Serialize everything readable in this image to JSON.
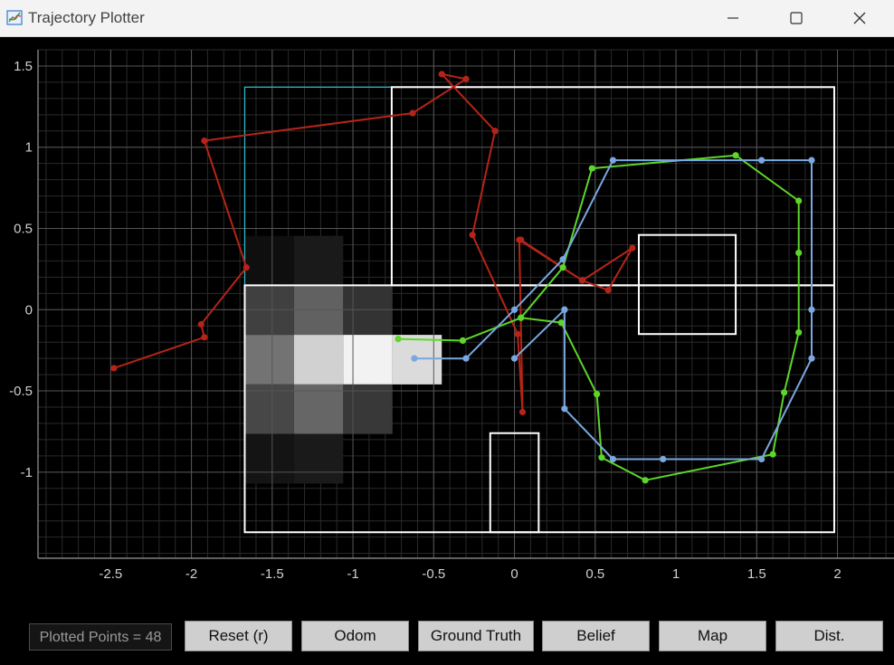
{
  "window": {
    "title": "Trajectory Plotter",
    "icon": "chart-app-icon",
    "minimize_icon": "minimize-icon",
    "maximize_icon": "maximize-icon",
    "close_icon": "close-icon"
  },
  "colors": {
    "odom": "#b52418",
    "ground_truth": "#5cd62a",
    "belief": "#7aa7e0",
    "map": "#ffffff",
    "highlight_rect": "#2fb8c8",
    "grid": "#555555",
    "background": "#000000"
  },
  "chart_data": {
    "type": "line",
    "xlim": [
      -2.95,
      2.35
    ],
    "ylim": [
      -1.53,
      1.6
    ],
    "x_ticks": [
      -2.5,
      -2,
      -1.5,
      -1,
      -0.5,
      0,
      0.5,
      1,
      1.5,
      2
    ],
    "x_tick_labels": [
      "-2.5",
      "-2",
      "-1.5",
      "-1",
      "-0.5",
      "0",
      "0.5",
      "1",
      "1.5",
      "2"
    ],
    "y_ticks": [
      1.5,
      1,
      0.5,
      0,
      -0.5,
      -1
    ],
    "y_tick_labels": [
      "1.5",
      "1",
      "0.5",
      "0",
      "-0.5",
      "-1"
    ],
    "grid": true,
    "series": [
      {
        "key": "odom",
        "x": [
          -2.48,
          -1.92,
          -1.94,
          -1.66,
          -1.92,
          -0.63,
          -0.3,
          -0.45,
          -0.12,
          -0.26,
          0.02,
          0.05,
          0.03,
          0.42,
          0.58,
          0.73,
          0.42,
          0.04
        ],
        "y": [
          -0.36,
          -0.17,
          -0.09,
          0.26,
          1.04,
          1.21,
          1.42,
          1.45,
          1.1,
          0.46,
          -0.15,
          -0.63,
          0.43,
          0.18,
          0.12,
          0.38,
          0.18,
          0.43
        ]
      },
      {
        "key": "ground_truth",
        "x": [
          -0.72,
          -0.32,
          0.04,
          0.3,
          0.48,
          1.37,
          1.76,
          1.76,
          1.76,
          1.67,
          1.6,
          0.81,
          0.54,
          0.51,
          0.29,
          0.04
        ],
        "y": [
          -0.18,
          -0.19,
          -0.05,
          0.26,
          0.87,
          0.95,
          0.67,
          0.35,
          -0.14,
          -0.51,
          -0.89,
          -1.05,
          -0.91,
          -0.52,
          -0.08,
          -0.05
        ]
      },
      {
        "key": "belief",
        "x": [
          -0.62,
          -0.3,
          0.0,
          0.3,
          0.61,
          1.53,
          1.84,
          1.84,
          1.84,
          1.53,
          0.92,
          0.61,
          0.31,
          0.31,
          0.0,
          0.31
        ],
        "y": [
          -0.3,
          -0.3,
          0.0,
          0.31,
          0.92,
          0.92,
          0.92,
          0.0,
          -0.3,
          -0.92,
          -0.92,
          -0.92,
          -0.61,
          0.0,
          -0.3,
          0.0
        ]
      }
    ],
    "map_rects": [
      {
        "x0": -0.76,
        "y0": 0.15,
        "x1": 1.98,
        "y1": 1.37
      },
      {
        "x0": -1.67,
        "y0": -1.37,
        "x1": 1.98,
        "y1": 0.15
      },
      {
        "x0": 0.77,
        "y0": -0.15,
        "x1": 1.37,
        "y1": 0.46
      },
      {
        "x0": -0.15,
        "y0": -1.37,
        "x1": 0.15,
        "y1": -0.76
      }
    ],
    "highlight_rect": {
      "x0": -1.67,
      "y0": 0.15,
      "x1": -0.76,
      "y1": 1.37
    },
    "heatmap": {
      "x0": -1.67,
      "y0": -1.07,
      "cell": 0.305,
      "rows_top_to_bottom": [
        [
          0.06,
          0.1,
          0.0,
          0.0
        ],
        [
          0.25,
          0.38,
          0.2,
          0.0
        ],
        [
          0.45,
          0.82,
          0.95,
          0.86
        ],
        [
          0.28,
          0.4,
          0.22,
          0.0
        ],
        [
          0.08,
          0.1,
          0.0,
          0.0
        ]
      ]
    }
  },
  "controls": {
    "points_readout": "Plotted Points = 48",
    "reset_label": "Reset (r)",
    "odom_label": "Odom",
    "ground_truth_label": "Ground Truth",
    "belief_label": "Belief",
    "map_label": "Map",
    "dist_label": "Dist."
  }
}
